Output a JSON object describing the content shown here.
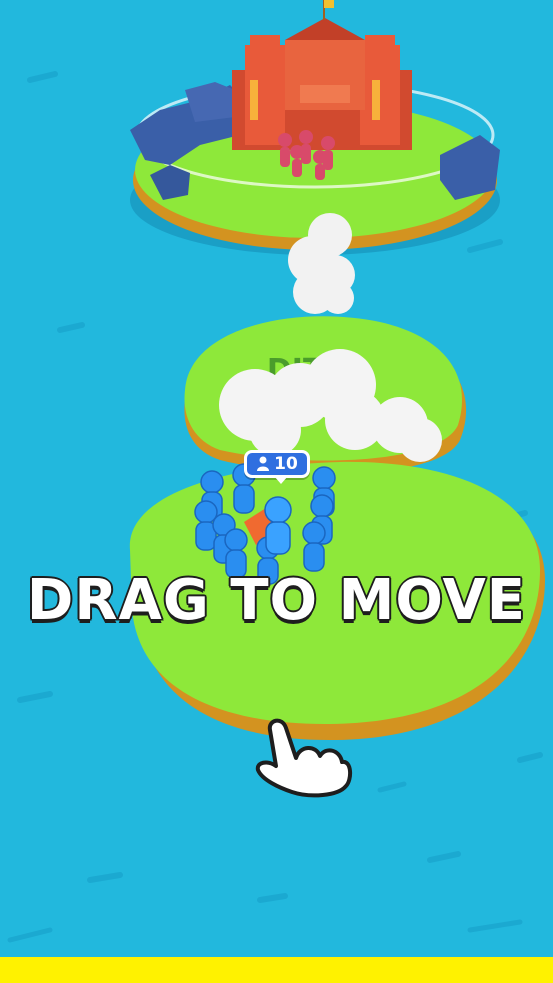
{
  "hud": {
    "crowd_count": "10",
    "person_icon": "person-icon"
  },
  "tutorial": {
    "instruction": "DRAG TO MOVE",
    "hand_icon": "pointing-hand-icon"
  },
  "island_sign": "DIT A",
  "colors": {
    "water": "#22b8dd",
    "grass": "#8ee83a",
    "island_edge": "#e0a628",
    "castle": "#e85a3a",
    "crowd": "#2a8ef0",
    "enemy": "#d84a6a",
    "bottom_bar": "#fff200"
  }
}
